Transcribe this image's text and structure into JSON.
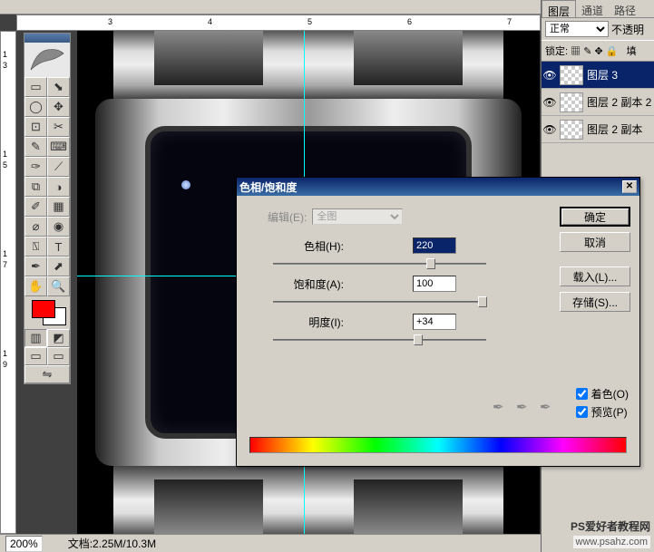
{
  "ruler_h": [
    "3",
    "4",
    "5",
    "6",
    "7"
  ],
  "ruler_v": [
    "1",
    "3",
    "1",
    "5",
    "1",
    "7",
    "1",
    "9"
  ],
  "toolbox_icons": [
    "▭",
    "⬊",
    "◯",
    "✥",
    "⊡",
    "✂",
    "✎",
    "⌨",
    "✑",
    "⟋",
    "⧉",
    "◑",
    "✐",
    "▦",
    "⌀",
    "◉",
    "⍂",
    "T",
    "✒",
    "⬈",
    "✎",
    "○",
    "✋",
    "🔍"
  ],
  "panels": {
    "tabs": [
      "图层",
      "通道",
      "路径"
    ],
    "blend_mode": "正常",
    "opacity_label": "不透明",
    "lock_label": "锁定:",
    "fill_label": "填",
    "layers": [
      {
        "name": "图层 3",
        "selected": true
      },
      {
        "name": "图层 2 副本 2",
        "selected": false
      },
      {
        "name": "图层 2 副本",
        "selected": false
      }
    ]
  },
  "dialog": {
    "title": "色相/饱和度",
    "edit_label": "编辑(E):",
    "edit_value": "全图",
    "hue_label": "色相(H):",
    "hue_value": "220",
    "sat_label": "饱和度(A):",
    "sat_value": "100",
    "light_label": "明度(I):",
    "light_value": "+34",
    "ok": "确定",
    "cancel": "取消",
    "load": "载入(L)...",
    "save": "存储(S)...",
    "colorize": "着色(O)",
    "preview": "预览(P)"
  },
  "status": {
    "zoom": "200%",
    "doc_label": "文档:",
    "doc_value": "2.25M/10.3M"
  },
  "watermark_main": "PS爱好者教程网",
  "watermark_url": "www.psahz.com"
}
